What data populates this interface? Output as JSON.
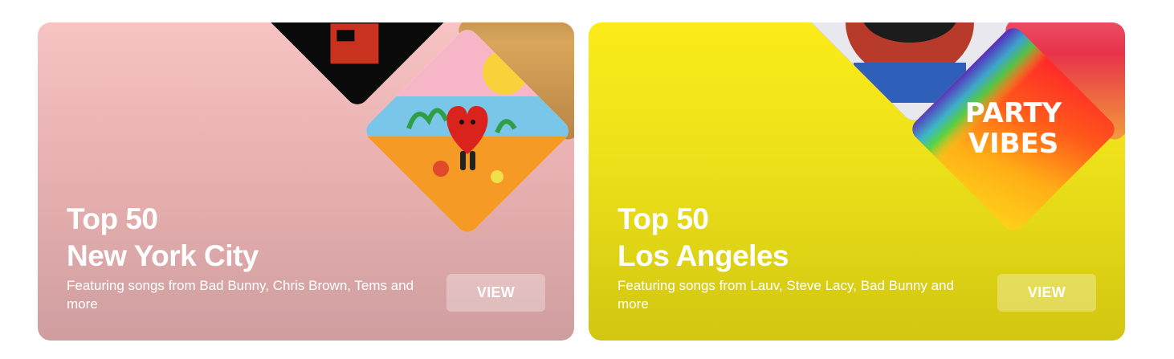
{
  "cards": [
    {
      "title_line1": "Top 50",
      "title_line2": "New York City",
      "description": "Featuring songs from Bad Bunny, Chris Brown, Tems and more",
      "button_label": "VIEW",
      "background_color": "#e9b1b1"
    },
    {
      "title_line1": "Top 50",
      "title_line2": "Los Angeles",
      "description": "Featuring songs from Lauv, Steve Lacy, Bad Bunny and more",
      "button_label": "VIEW",
      "background_color": "#ece01a",
      "art_text_line1": "PARTY",
      "art_text_line2": "VIBES"
    }
  ]
}
